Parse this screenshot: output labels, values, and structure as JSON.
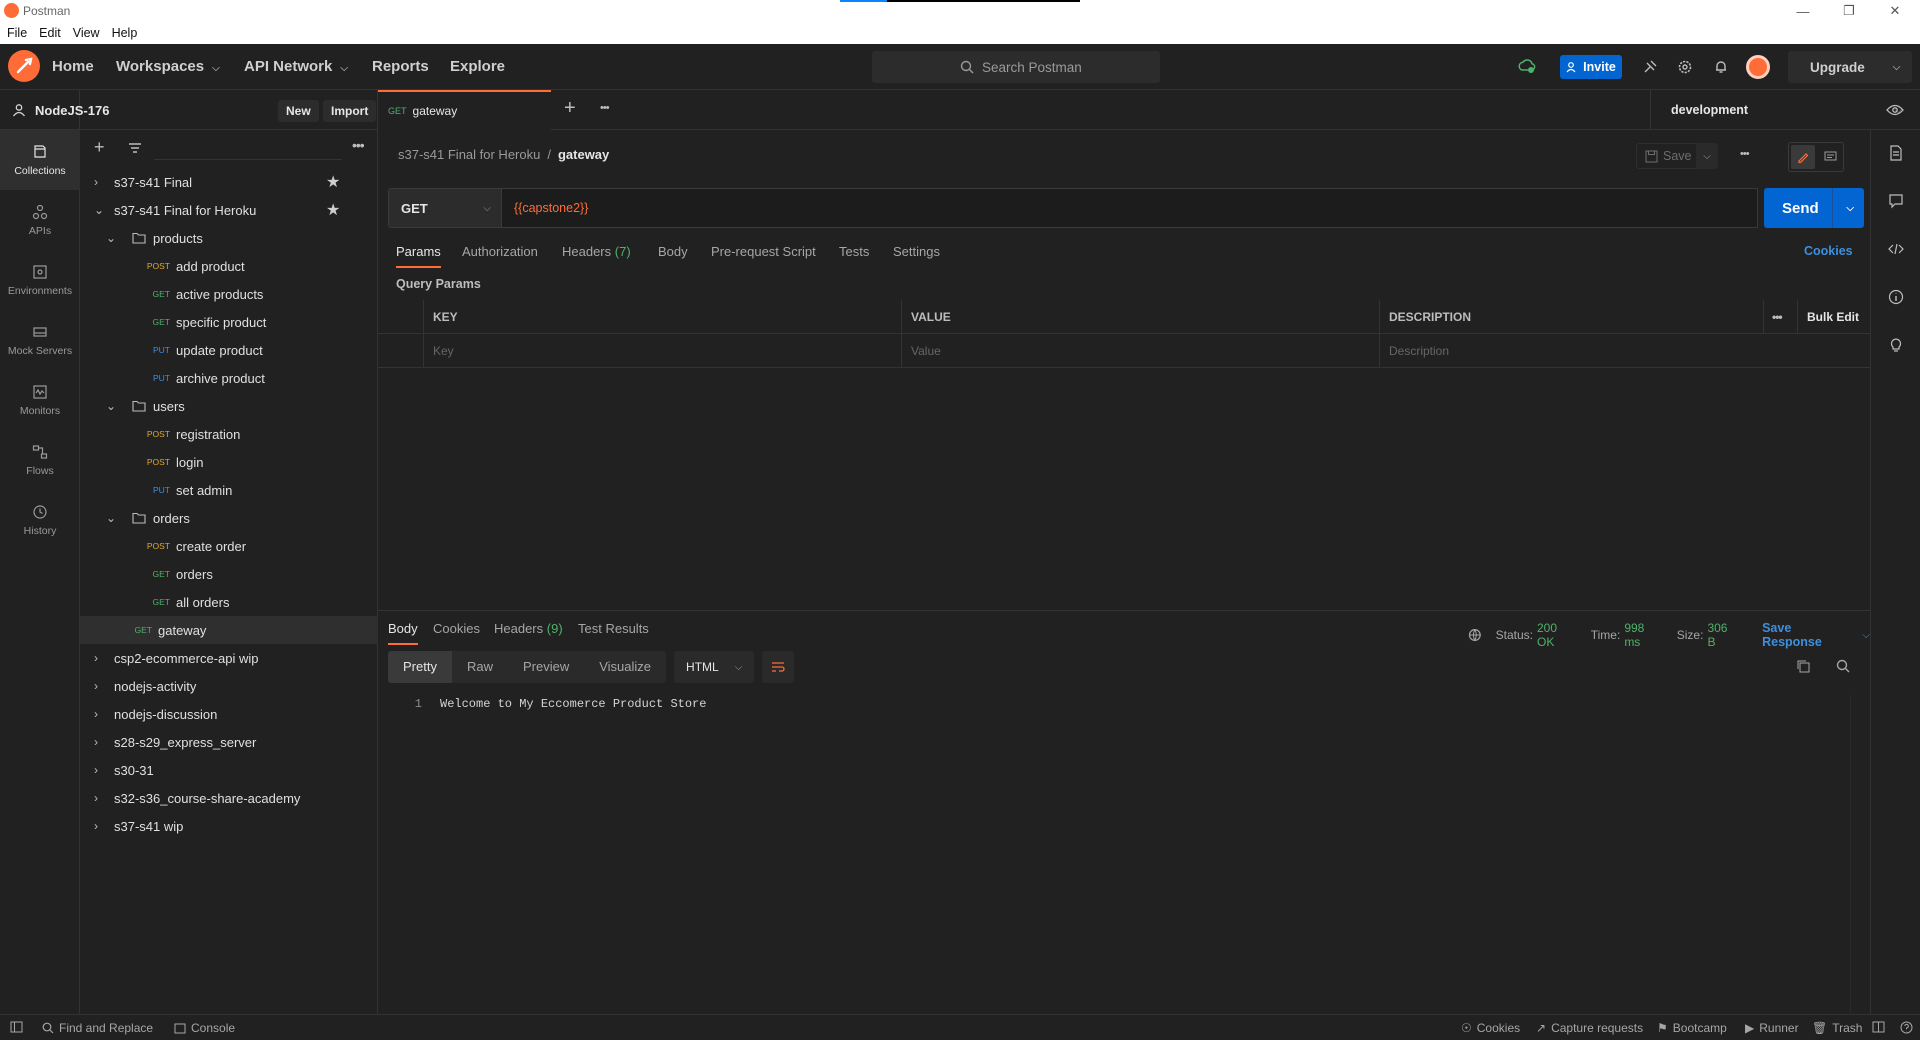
{
  "window": {
    "title": "Postman"
  },
  "menu": [
    "File",
    "Edit",
    "View",
    "Help"
  ],
  "header": {
    "nav": [
      {
        "label": "Home",
        "has_chevron": false
      },
      {
        "label": "Workspaces",
        "has_chevron": true
      },
      {
        "label": "API Network",
        "has_chevron": true
      },
      {
        "label": "Reports",
        "has_chevron": false
      },
      {
        "label": "Explore",
        "has_chevron": false
      }
    ],
    "search_placeholder": "Search Postman",
    "invite_label": "Invite",
    "upgrade_label": "Upgrade"
  },
  "rail": [
    {
      "label": "Collections",
      "icon": "collections-icon",
      "active": true
    },
    {
      "label": "APIs",
      "icon": "apis-icon",
      "active": false
    },
    {
      "label": "Environments",
      "icon": "environments-icon",
      "active": false
    },
    {
      "label": "Mock Servers",
      "icon": "mock-servers-icon",
      "active": false
    },
    {
      "label": "Monitors",
      "icon": "monitors-icon",
      "active": false
    },
    {
      "label": "Flows",
      "icon": "flows-icon",
      "active": false
    },
    {
      "label": "History",
      "icon": "history-icon",
      "active": false
    }
  ],
  "workspace": {
    "name": "NodeJS-176",
    "new_label": "New",
    "import_label": "Import"
  },
  "tree": [
    {
      "kind": "collection",
      "label": "s37-s41 Final",
      "expanded": false,
      "starred": true
    },
    {
      "kind": "collection",
      "label": "s37-s41 Final for Heroku",
      "expanded": true,
      "starred": true
    },
    {
      "kind": "folder",
      "label": "products"
    },
    {
      "kind": "request",
      "method": "POST",
      "label": "add product"
    },
    {
      "kind": "request",
      "method": "GET",
      "label": "active products"
    },
    {
      "kind": "request",
      "method": "GET",
      "label": "specific product"
    },
    {
      "kind": "request",
      "method": "PUT",
      "label": "update product"
    },
    {
      "kind": "request",
      "method": "PUT",
      "label": "archive product"
    },
    {
      "kind": "folder",
      "label": "users"
    },
    {
      "kind": "request",
      "method": "POST",
      "label": "registration"
    },
    {
      "kind": "request",
      "method": "POST",
      "label": "login"
    },
    {
      "kind": "request",
      "method": "PUT",
      "label": "set admin"
    },
    {
      "kind": "folder",
      "label": "orders"
    },
    {
      "kind": "request",
      "method": "POST",
      "label": "create order"
    },
    {
      "kind": "request",
      "method": "GET",
      "label": "orders"
    },
    {
      "kind": "request",
      "method": "GET",
      "label": "all orders"
    },
    {
      "kind": "toprequest",
      "method": "GET",
      "label": "gateway",
      "selected": true
    },
    {
      "kind": "collection",
      "label": "csp2-ecommerce-api wip",
      "expanded": false
    },
    {
      "kind": "collection",
      "label": "nodejs-activity",
      "expanded": false
    },
    {
      "kind": "collection",
      "label": "nodejs-discussion",
      "expanded": false
    },
    {
      "kind": "collection",
      "label": "s28-s29_express_server",
      "expanded": false
    },
    {
      "kind": "collection",
      "label": "s30-31",
      "expanded": false
    },
    {
      "kind": "collection",
      "label": "s32-s36_course-share-academy",
      "expanded": false
    },
    {
      "kind": "collection",
      "label": "s37-s41 wip",
      "expanded": false
    }
  ],
  "tab": {
    "method": "GET",
    "label": "gateway"
  },
  "environment": "development",
  "breadcrumb": {
    "parent": "s37-s41 Final for Heroku",
    "sep": "/",
    "current": "gateway"
  },
  "save_label": "Save",
  "request": {
    "method": "GET",
    "url": "{{capstone2}}",
    "send_label": "Send"
  },
  "req_tabs": [
    {
      "label": "Params",
      "active": true
    },
    {
      "label": "Authorization"
    },
    {
      "label": "Headers",
      "count": "(7)"
    },
    {
      "label": "Body"
    },
    {
      "label": "Pre-request Script"
    },
    {
      "label": "Tests"
    },
    {
      "label": "Settings"
    }
  ],
  "cookies_label": "Cookies",
  "query_params": {
    "title": "Query Params",
    "columns": [
      "KEY",
      "VALUE",
      "DESCRIPTION"
    ],
    "placeholders": [
      "Key",
      "Value",
      "Description"
    ],
    "bulk_edit": "Bulk Edit"
  },
  "response": {
    "tabs": [
      {
        "label": "Body",
        "active": true
      },
      {
        "label": "Cookies"
      },
      {
        "label": "Headers",
        "count": "(9)"
      },
      {
        "label": "Test Results"
      }
    ],
    "status_label": "Status:",
    "status": "200 OK",
    "time_label": "Time:",
    "time": "998 ms",
    "size_label": "Size:",
    "size": "306 B",
    "save_response": "Save Response",
    "formats": [
      "Pretty",
      "Raw",
      "Preview",
      "Visualize"
    ],
    "language": "HTML",
    "lines": [
      {
        "n": "1",
        "text": "Welcome to My Eccomerce Product Store"
      }
    ]
  },
  "statusbar": {
    "left": [
      "Find and Replace",
      "Console"
    ],
    "right": [
      "Cookies",
      "Capture requests",
      "Bootcamp",
      "Runner",
      "Trash"
    ]
  },
  "colors": {
    "accent": "#ff6c37",
    "primary": "#0265d2",
    "get": "#4fb26a",
    "post": "#e5a72b",
    "put": "#3d8fe0"
  }
}
